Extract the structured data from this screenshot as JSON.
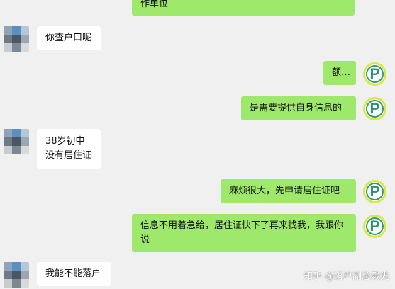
{
  "messages": [
    {
      "side": "out",
      "text": "作单位"
    },
    {
      "side": "in",
      "text": "你查户口呢"
    },
    {
      "side": "out",
      "text": "额…"
    },
    {
      "side": "out",
      "text": "是需要提供自身信息的"
    },
    {
      "side": "in",
      "text": "38岁初中\n没有居住证"
    },
    {
      "side": "out",
      "text": "麻烦很大，先申请居住证吧"
    },
    {
      "side": "out",
      "text": "信息不用着急给，居住证快下了再来找我，我跟你说"
    },
    {
      "side": "in",
      "text": "我能不能落户"
    }
  ],
  "avatars": {
    "contact": "mosaic-avatar",
    "self": {
      "letter": "P",
      "icon": "p-logo-icon"
    }
  },
  "watermark": {
    "text": "知乎 @落户副总裁先"
  },
  "colors": {
    "background": "#f0f0f0",
    "incoming_bubble": "#ffffff",
    "outgoing_bubble": "#9ee86b"
  }
}
